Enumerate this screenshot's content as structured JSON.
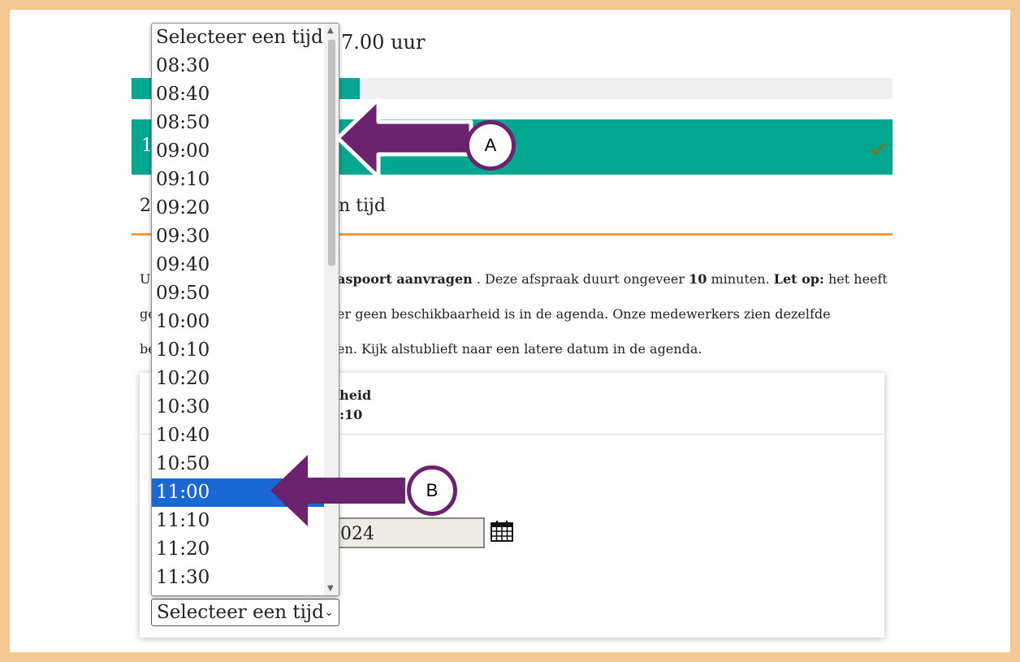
{
  "page": {
    "hours_text": "7.00 uur",
    "progress_percent": 30,
    "step1_number": "1",
    "step2_number": "2",
    "step2_label": "n tijd",
    "info_lines": [
      {
        "prefix": "U",
        "bold": "aspoort aanvragen",
        "mid": " . Deze afspraak duurt ongeveer ",
        "bold2": "10",
        "mid2": " minuten. ",
        "bold3": "Let op:",
        "suffix": " het heeft"
      },
      {
        "prefix": "ge",
        "rest": "er geen beschikbaarheid is in de agenda. Onze medewerkers zien dezelfde"
      },
      {
        "prefix": "be",
        "rest": "en. Kijk alstublieft naar een latere datum in de agenda."
      }
    ],
    "availability_title": "kheid",
    "availability_time": "0:10",
    "date_value": "024"
  },
  "select": {
    "placeholder": "Selecteer een tijd",
    "selected_value": "Selecteer een tijd",
    "options": [
      "Selecteer een tijd",
      "08:30",
      "08:40",
      "08:50",
      "09:00",
      "09:10",
      "09:20",
      "09:30",
      "09:40",
      "09:50",
      "10:00",
      "10:10",
      "10:20",
      "10:30",
      "10:40",
      "10:50",
      "11:00",
      "11:10",
      "11:20",
      "11:30"
    ],
    "highlighted_option": "11:00"
  },
  "annotations": {
    "marker_a": "A",
    "marker_b": "B",
    "arrow_color": "#6b2370"
  },
  "colors": {
    "teal": "#03a790",
    "orange": "#f39a3b",
    "highlight": "#1a67d6",
    "frame": "#f3c893"
  }
}
